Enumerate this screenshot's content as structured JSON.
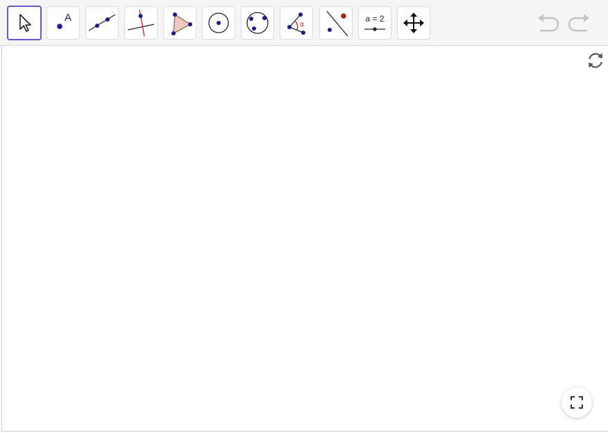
{
  "toolbar": {
    "tools": [
      {
        "name": "move-tool",
        "icon": "arrow-cursor-icon",
        "active": true
      },
      {
        "name": "point-tool",
        "icon": "point-icon",
        "label": "A"
      },
      {
        "name": "line-tool",
        "icon": "line-through-points-icon"
      },
      {
        "name": "perpendicular-line-tool",
        "icon": "perpendicular-line-icon"
      },
      {
        "name": "polygon-tool",
        "icon": "polygon-icon"
      },
      {
        "name": "circle-center-point-tool",
        "icon": "circle-center-icon"
      },
      {
        "name": "circle-three-points-tool",
        "icon": "circle-three-points-icon"
      },
      {
        "name": "angle-tool",
        "icon": "angle-icon",
        "label": "α"
      },
      {
        "name": "reflect-about-line-tool",
        "icon": "reflect-line-icon"
      },
      {
        "name": "slider-tool",
        "icon": "slider-icon",
        "label": "a = 2"
      },
      {
        "name": "move-graphics-view-tool",
        "icon": "move-view-icon"
      }
    ],
    "undo_icon": "undo-icon",
    "redo_icon": "redo-icon"
  },
  "graphics_view": {
    "reset_icon": "reset-icon",
    "fullscreen_icon": "fullscreen-icon"
  },
  "colors": {
    "accent": "#6557d2",
    "point": "#1a1a8c",
    "red": "#d11a1a",
    "polygon_fill": "#f2c9c0"
  }
}
